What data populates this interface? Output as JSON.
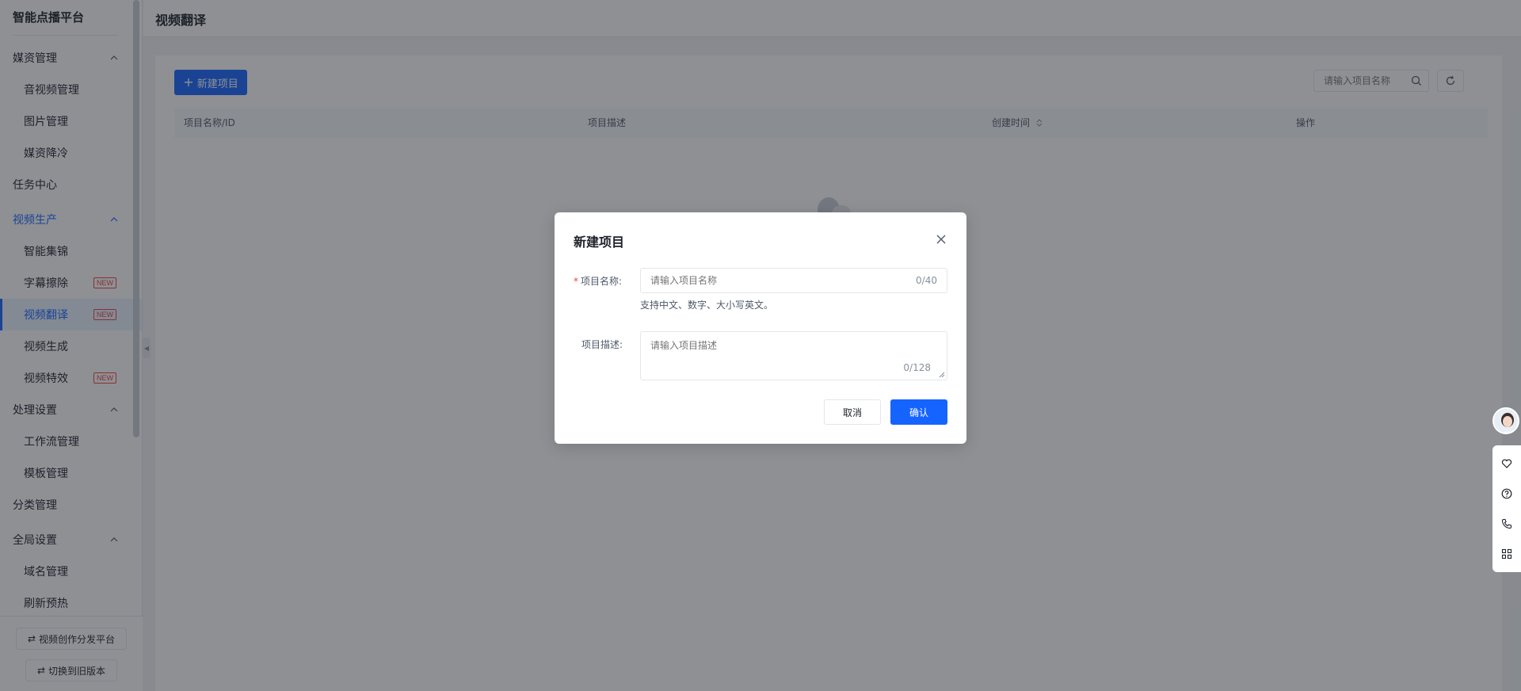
{
  "app": {
    "brand": "智能点播平台",
    "page_title": "视频翻译"
  },
  "sidebar": {
    "groups": [
      {
        "label": "媒资管理",
        "items": [
          "音视频管理",
          "图片管理",
          "媒资降冷"
        ]
      },
      {
        "label": "任务中心",
        "items": []
      },
      {
        "label": "视频生产",
        "items": [
          "智能集锦",
          "字幕擦除",
          "视频翻译",
          "视频生成",
          "视频特效"
        ]
      },
      {
        "label": "处理设置",
        "items": [
          "工作流管理",
          "模板管理"
        ]
      },
      {
        "label": "分类管理",
        "items": []
      },
      {
        "label": "全局设置",
        "items": [
          "域名管理",
          "刷新预热"
        ]
      }
    ],
    "new_badge": "NEW",
    "active_item": "视频翻译",
    "footer": {
      "btn1": "视频创作分发平台",
      "btn2": "切换到旧版本"
    }
  },
  "main": {
    "new_button": "新建项目",
    "search": {
      "placeholder": "请输入项目名称"
    },
    "table": {
      "columns": [
        "项目名称/ID",
        "项目描述",
        "创建时间",
        "操作"
      ]
    }
  },
  "modal": {
    "title": "新建项目",
    "name_label": "项目名称:",
    "name_placeholder": "请输入项目名称",
    "name_count": "0/40",
    "name_hint": "支持中文、数字、大小写英文。",
    "desc_label": "项目描述:",
    "desc_placeholder": "请输入项目描述",
    "desc_count": "0/128",
    "cancel": "取消",
    "confirm": "确认"
  },
  "colors": {
    "primary": "#1664ff",
    "danger": "#f53f3f"
  }
}
